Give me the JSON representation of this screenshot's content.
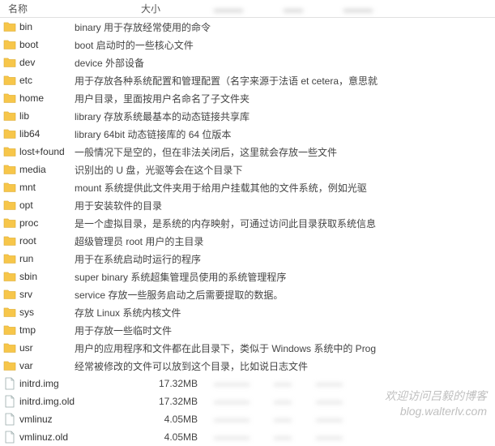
{
  "header": {
    "name": "名称",
    "size": "大小"
  },
  "folders": [
    {
      "name": "bin",
      "desc": "binary 用于存放经常使用的命令"
    },
    {
      "name": "boot",
      "desc": "boot 启动时的一些核心文件"
    },
    {
      "name": "dev",
      "desc": "device 外部设备"
    },
    {
      "name": "etc",
      "desc": "用于存放各种系统配置和管理配置（名字来源于法语 et cetera，意思就"
    },
    {
      "name": "home",
      "desc": "用户目录，里面按用户名命名了子文件夹"
    },
    {
      "name": "lib",
      "desc": "library 存放系统最基本的动态链接共享库"
    },
    {
      "name": "lib64",
      "desc": "library 64bit 动态链接库的 64 位版本"
    },
    {
      "name": "lost+found",
      "desc": "一般情况下是空的，但在非法关闭后，这里就会存放一些文件"
    },
    {
      "name": "media",
      "desc": "识别出的 U 盘，光驱等会在这个目录下"
    },
    {
      "name": "mnt",
      "desc": "mount 系统提供此文件夹用于给用户挂载其他的文件系统，例如光驱"
    },
    {
      "name": "opt",
      "desc": "用于安装软件的目录"
    },
    {
      "name": "proc",
      "desc": "是一个虚拟目录，是系统的内存映射，可通过访问此目录获取系统信息"
    },
    {
      "name": "root",
      "desc": "超级管理员 root 用户的主目录"
    },
    {
      "name": "run",
      "desc": "用于在系统启动时运行的程序"
    },
    {
      "name": "sbin",
      "desc": "super binary 系统超集管理员使用的系统管理程序"
    },
    {
      "name": "srv",
      "desc": "service 存放一些服务启动之后需要提取的数据。"
    },
    {
      "name": "sys",
      "desc": "存放 Linux 系统内核文件"
    },
    {
      "name": "tmp",
      "desc": "用于存放一些临时文件"
    },
    {
      "name": "usr",
      "desc": "用户的应用程序和文件都在此目录下，类似于 Windows 系统中的 Prog"
    },
    {
      "name": "var",
      "desc": "经常被修改的文件可以放到这个目录，比如说日志文件"
    }
  ],
  "files": [
    {
      "name": "initrd.img",
      "size": "17.32MB"
    },
    {
      "name": "initrd.img.old",
      "size": "17.32MB"
    },
    {
      "name": "vmlinuz",
      "size": "4.05MB"
    },
    {
      "name": "vmlinuz.old",
      "size": "4.05MB"
    }
  ],
  "watermark": {
    "line1": "欢迎访问吕毅的博客",
    "line2": "blog.walterlv.com"
  }
}
